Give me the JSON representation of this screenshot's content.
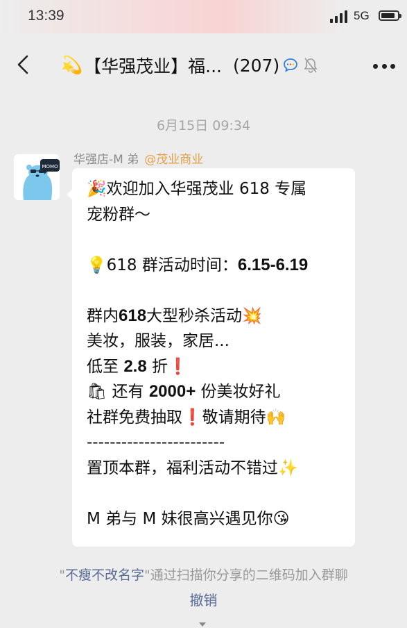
{
  "status_bar": {
    "time": "13:39",
    "network": "5G",
    "battery_level": 0.85
  },
  "nav": {
    "title_emoji": "💫",
    "title": "【华强茂业】福...",
    "member_count": "(207)",
    "icons": [
      "back-icon",
      "chat-bubble-icon",
      "bell-muted-icon",
      "more-icon"
    ]
  },
  "chat": {
    "timestamp": "6月15日 09:34",
    "message": {
      "sender_name": "华强店-M 弟",
      "sender_tag": "@茂业商业",
      "lines": [
        {
          "a": "🎉欢迎加入华强茂业 618 专属",
          "b": "",
          "c": ""
        },
        {
          "a": "宠粉群～",
          "b": "",
          "c": ""
        },
        {
          "a": "",
          "b": "",
          "c": ""
        },
        {
          "a": "💡618 群活动时间：",
          "b": "6.15-6.19",
          "c": ""
        },
        {
          "a": "",
          "b": "",
          "c": ""
        },
        {
          "a": "群内",
          "b": "618",
          "c": "大型秒杀活动💥"
        },
        {
          "a": "美妆，服装，家居...",
          "b": "",
          "c": ""
        },
        {
          "a": "低至 ",
          "b": "2.8",
          "c": " 折❗"
        },
        {
          "a": "🛍 还有 ",
          "b": "2000+",
          "c": " 份美妆好礼"
        },
        {
          "a": "社群免费抽取❗敬请期待🙌",
          "b": "",
          "c": ""
        },
        {
          "a": "------------------------",
          "b": "",
          "c": ""
        },
        {
          "a": "置顶本群，福利活动不错过✨",
          "b": "",
          "c": ""
        },
        {
          "a": "",
          "b": "",
          "c": ""
        },
        {
          "a": "M 弟与 M 妹很高兴遇见你😘",
          "b": "",
          "c": ""
        }
      ]
    },
    "system_message": {
      "quote_open": "\"",
      "user": "不瘦不改名字",
      "quote_close": "\"",
      "text": "通过扫描你分享的二维码加入群聊"
    },
    "revoke_label": "撤销"
  },
  "colors": {
    "link": "#576b95",
    "tag": "#e2a247",
    "background": "#ededed",
    "bubble": "#ffffff"
  }
}
